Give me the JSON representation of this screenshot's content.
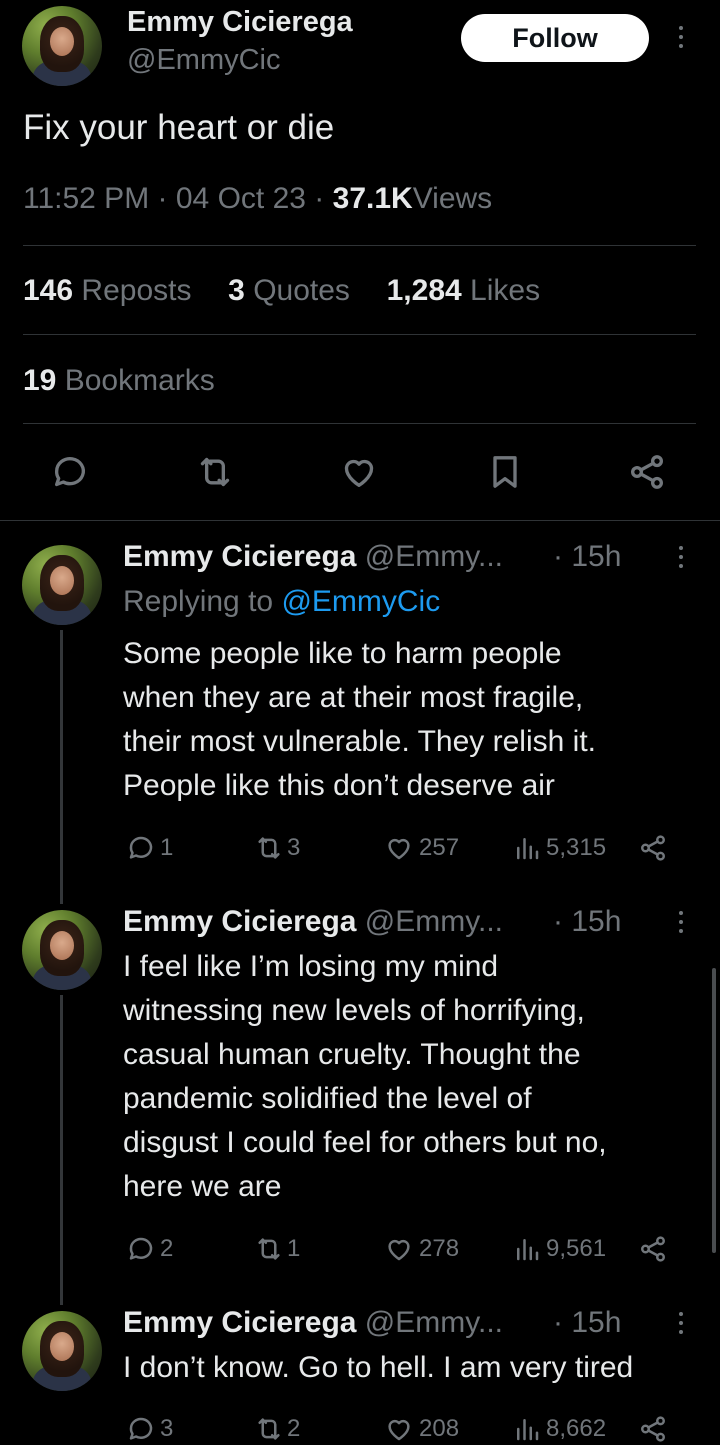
{
  "main_tweet": {
    "display_name": "Emmy Cicierega",
    "handle": "@EmmyCic",
    "follow_label": "Follow",
    "text": "Fix your heart or die",
    "time": "11:52 PM",
    "date": "04 Oct 23",
    "views_count": "37.1K",
    "views_label": "Views",
    "sep": "·",
    "reposts_count": "146",
    "reposts_label": "Reposts",
    "quotes_count": "3",
    "quotes_label": "Quotes",
    "likes_count": "1,284",
    "likes_label": "Likes",
    "bookmarks_count": "19",
    "bookmarks_label": "Bookmarks"
  },
  "replies": [
    {
      "display_name": "Emmy Cicierega",
      "handle": "@Emmy...",
      "time": "· 15h",
      "replying_prefix": "Replying to",
      "replying_handle": "@EmmyCic",
      "lines": [
        "Some people like to harm people",
        "when they are at their most fragile,",
        "their most vulnerable. They relish it.",
        "People like this don’t deserve air"
      ],
      "replies": "1",
      "reposts": "3",
      "likes": "257",
      "views": "5,315"
    },
    {
      "display_name": "Emmy Cicierega",
      "handle": "@Emmy...",
      "time": "· 15h",
      "lines": [
        "I feel like I’m losing my mind",
        "witnessing new levels of horrifying,",
        "casual human cruelty. Thought the",
        "pandemic solidified the level of",
        "disgust I could feel for others but no,",
        "here we are"
      ],
      "replies": "2",
      "reposts": "1",
      "likes": "278",
      "views": "9,561"
    },
    {
      "display_name": "Emmy Cicierega",
      "handle": "@Emmy...",
      "time": "· 15h",
      "lines": [
        "I don’t know. Go to hell. I am very tired"
      ],
      "replies": "3",
      "reposts": "2",
      "likes": "208",
      "views": "8,662"
    }
  ],
  "colors": {
    "background": "#000000",
    "text": "#e7e9ea",
    "muted": "#71767b",
    "link": "#1d9bf0",
    "divider": "#2f3336"
  },
  "icons": [
    "more-icon",
    "reply-icon",
    "repost-icon",
    "like-icon",
    "bookmark-icon",
    "share-icon",
    "views-icon"
  ]
}
